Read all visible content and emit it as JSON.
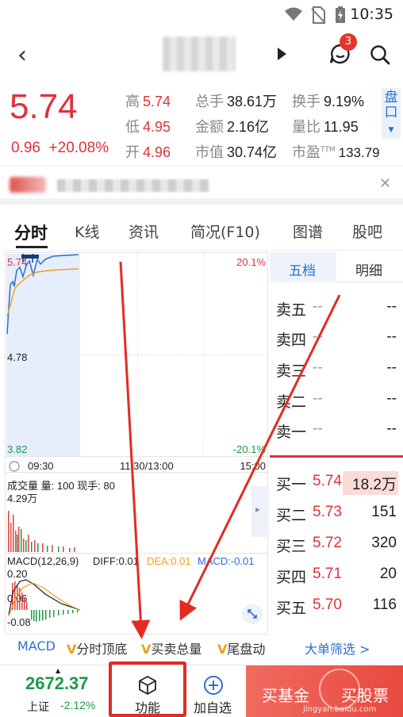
{
  "status_bar": {
    "time": "10:35"
  },
  "header": {
    "notification_count": "3"
  },
  "quote": {
    "price": "5.74",
    "change": "0.96",
    "change_pct": "+20.08%",
    "high_label": "高",
    "high": "5.74",
    "low_label": "低",
    "low": "4.95",
    "open_label": "开",
    "open": "4.96",
    "volume_label": "总手",
    "volume": "38.61万",
    "amount_label": "金额",
    "amount": "2.16亿",
    "mktcap_label": "市值",
    "mktcap": "30.74亿",
    "turnover_label": "换手",
    "turnover": "9.19%",
    "volratio_label": "量比",
    "volratio": "11.95",
    "pe_label": "市盈",
    "pe_sup": "TTM",
    "pe": "133.79",
    "pankou_label": "盘口"
  },
  "tabs": [
    "分时",
    "K线",
    "资讯",
    "简况(F10)",
    "图谱",
    "股吧"
  ],
  "chart": {
    "price_top": "5.74",
    "price_mid": "4.78",
    "price_bottom": "3.82",
    "pct_top": "20.1%",
    "pct_bottom": "-20.1%",
    "time_start": "09:30",
    "time_mid": "11:30/13:00",
    "time_end": "15:00",
    "volume_title": "成交量",
    "volume_label": "量:",
    "volume_value": "100",
    "current_label": "现手:",
    "current_value": "80",
    "volume_axis": "4.29万",
    "macd_title": "MACD(12,26,9)",
    "diff": "DIFF:0.01",
    "dea": "DEA:0.01",
    "macd": "MACD:-0.01",
    "macd_top": "0.20",
    "macd_mid": "0.06",
    "macd_bottom": "-0.08"
  },
  "order_book": {
    "tab_five": "五档",
    "tab_detail": "明细",
    "asks": [
      {
        "label": "卖五",
        "price": "--",
        "volume": "--"
      },
      {
        "label": "卖四",
        "price": "--",
        "volume": "--"
      },
      {
        "label": "卖三",
        "price": "--",
        "volume": "--"
      },
      {
        "label": "卖二",
        "price": "--",
        "volume": "--"
      },
      {
        "label": "卖一",
        "price": "--",
        "volume": "--"
      }
    ],
    "bids": [
      {
        "label": "买一",
        "price": "5.74",
        "volume": "18.2万"
      },
      {
        "label": "买二",
        "price": "5.73",
        "volume": "151"
      },
      {
        "label": "买三",
        "price": "5.72",
        "volume": "320"
      },
      {
        "label": "买四",
        "price": "5.71",
        "volume": "20"
      },
      {
        "label": "买五",
        "price": "5.70",
        "volume": "116"
      }
    ]
  },
  "function_bar": {
    "macd": "MACD",
    "v_mark": "V",
    "top_bottom": "分时顶底",
    "total_buy_sell": "买卖总量",
    "tail": "尾盘动",
    "big_order": "大单筛选 >"
  },
  "bottom_bar": {
    "index_value": "2672.37",
    "index_name": "上证",
    "index_change": "-2.12%",
    "function_label": "功能",
    "add_label": "加自选",
    "buy_fund": "买基金",
    "buy_stock": "买股票",
    "watermark": "jingyan.baidu.com"
  },
  "colors": {
    "up": "#e0323a",
    "down": "#1c9a4a",
    "accent": "#2b6fd3",
    "highlight": "#e32b22"
  }
}
